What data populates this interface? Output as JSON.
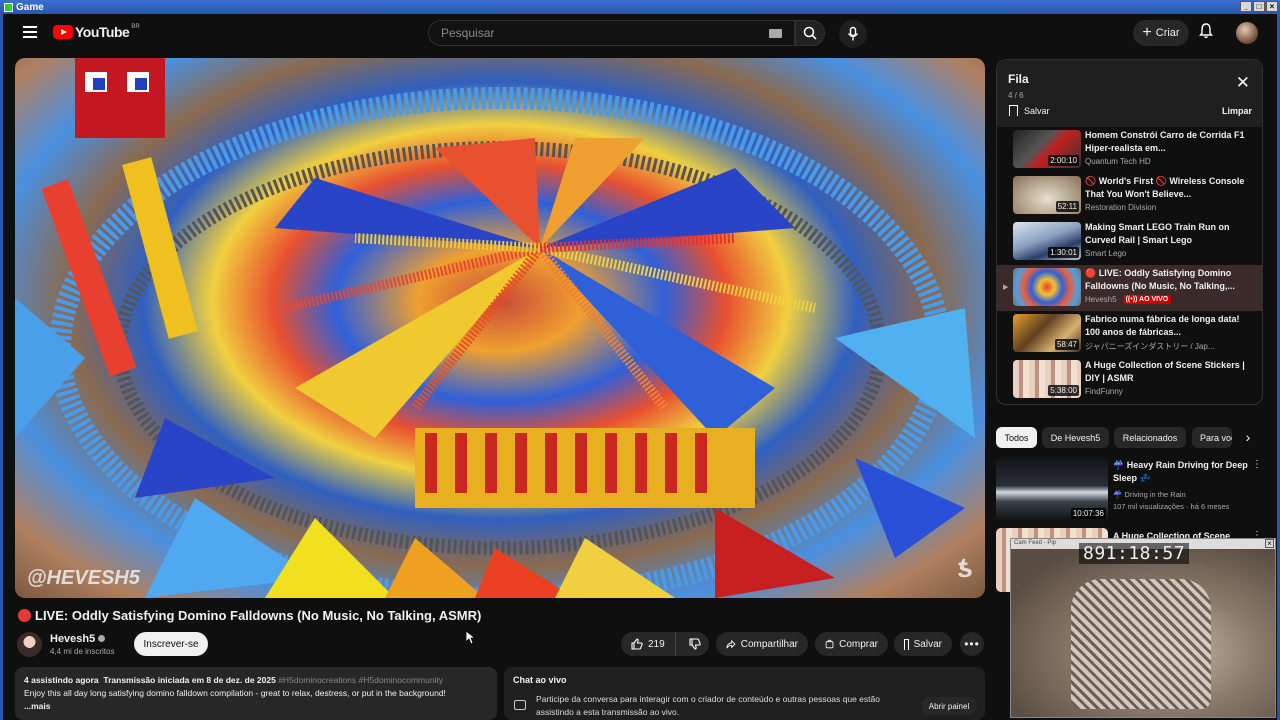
{
  "window": {
    "title": "Game"
  },
  "header": {
    "logo": "YouTube",
    "logo_country": "BR",
    "search_placeholder": "Pesquisar",
    "create_label": "Criar"
  },
  "video": {
    "watermark": "@HEVESH5",
    "title": "LIVE: Oddly Satisfying Domino Falldowns (No Music, No Talking, ASMR)",
    "channel": "Hevesh5",
    "subscribers": "4,4 mi de inscritos",
    "subscribe_label": "Inscrever-se",
    "likes": "219",
    "share_label": "Compartilhar",
    "buy_label": "Comprar",
    "save_label": "Salvar"
  },
  "description": {
    "watching": "4 assistindo agora",
    "started": "Transmissão iniciada em 8 de dez. de 2025",
    "tags": "#H5dominocreations #H5dominocommunity",
    "text": "Enjoy this all day long satisfying domino falldown compilation - great to relax, destress, or put in the background!",
    "more": "...mais"
  },
  "chat": {
    "title": "Chat ao vivo",
    "text": "Participe da conversa para interagir com o criador de conteúdo e outras pessoas que estão assistindo a esta transmissão ao vivo.",
    "open_label": "Abrir painel"
  },
  "queue": {
    "title": "Fila",
    "count": "4 / 6",
    "save_label": "Salvar",
    "clear_label": "Limpar",
    "items": [
      {
        "title": "Homem Constrói Carro de Corrida F1 Hiper-realista em...",
        "channel": "Quantum Tech HD",
        "duration": "2:00:10",
        "active": false
      },
      {
        "title": "🚫 World's First 🚫 Wireless Console That You Won't Believe...",
        "channel": "Restoration Division",
        "duration": "52:11",
        "active": false
      },
      {
        "title": "Making Smart LEGO Train Run on Curved Rail | Smart Lego",
        "channel": "Smart Lego",
        "duration": "1:30:01",
        "active": false
      },
      {
        "title": "🔴 LIVE: Oddly Satisfying Domino Falldowns (No Music, No Talking,...",
        "channel": "Hevesh5",
        "duration": "",
        "live": "((•)) AO VIVO",
        "active": true
      },
      {
        "title": "Fabrico numa fábrica de longa data! 100 anos de fábricas...",
        "channel": "ジャパニーズインダストリー / Jap...",
        "duration": "58:47",
        "active": false
      },
      {
        "title": "A Huge Collection of Scene Stickers | DIY | ASMR",
        "channel": "FindFunny",
        "duration": "5:38:00",
        "active": false
      }
    ]
  },
  "chips": [
    "Todos",
    "De Hevesh5",
    "Relacionados",
    "Para você"
  ],
  "recommended": [
    {
      "title": "☔ Heavy Rain Driving for Deep Sleep 💤",
      "channel": "☔ Driving in the Rain",
      "meta": "107 mil visualizações · há 6 meses",
      "duration": "10:07:36"
    },
    {
      "title": "A Huge Collection of Scene",
      "channel": "",
      "meta": "",
      "duration": ""
    }
  ],
  "pip": {
    "title": "Cam Feed - Pip",
    "time": "891:18:57"
  },
  "colors": {
    "accent": "#ff0000",
    "live": "#cc0000",
    "background": "#0f0f0f"
  }
}
